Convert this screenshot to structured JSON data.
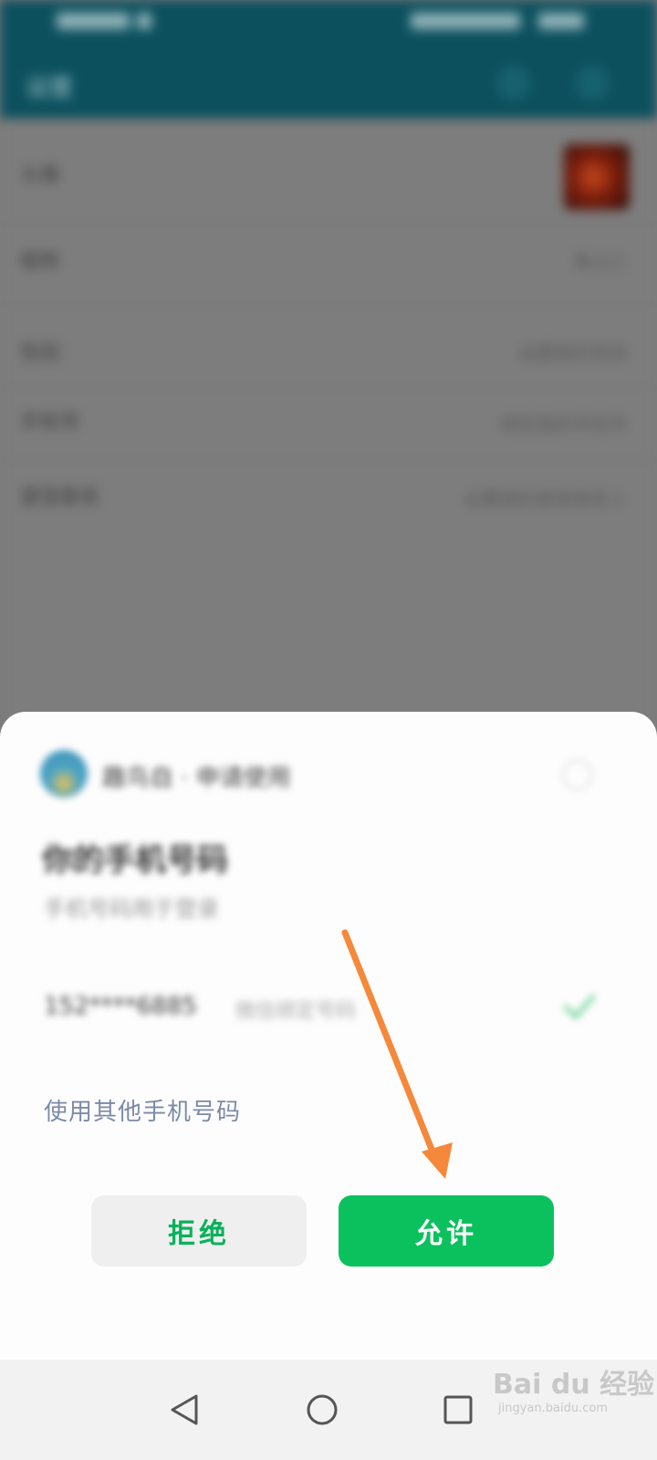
{
  "background_app": {
    "title": "设置",
    "rows": [
      {
        "label": "头像",
        "value": ""
      },
      {
        "label": "昵称",
        "value": "青山三"
      },
      {
        "label": "性别",
        "value": "设置我的性别"
      },
      {
        "label": "手机号",
        "value": "绑定我的手机号"
      },
      {
        "label": "紧急联系",
        "value": "设置我的紧急联系人"
      }
    ]
  },
  "sheet": {
    "app_name": "趣鸟自 · 申请使用",
    "title": "你的手机号码",
    "subtitle": "手机号码用于登录",
    "phone_number": "152****6885",
    "phone_note": "微信绑定号码",
    "other_phone_label": "使用其他手机号码",
    "deny_label": "拒绝",
    "allow_label": "允许"
  },
  "watermark": {
    "text": "Bai du 经验",
    "sub": "jingyan.baidu.com"
  },
  "colors": {
    "accent_green": "#0bc15e",
    "header_teal": "#0c505e",
    "arrow_orange": "#f5883a"
  }
}
